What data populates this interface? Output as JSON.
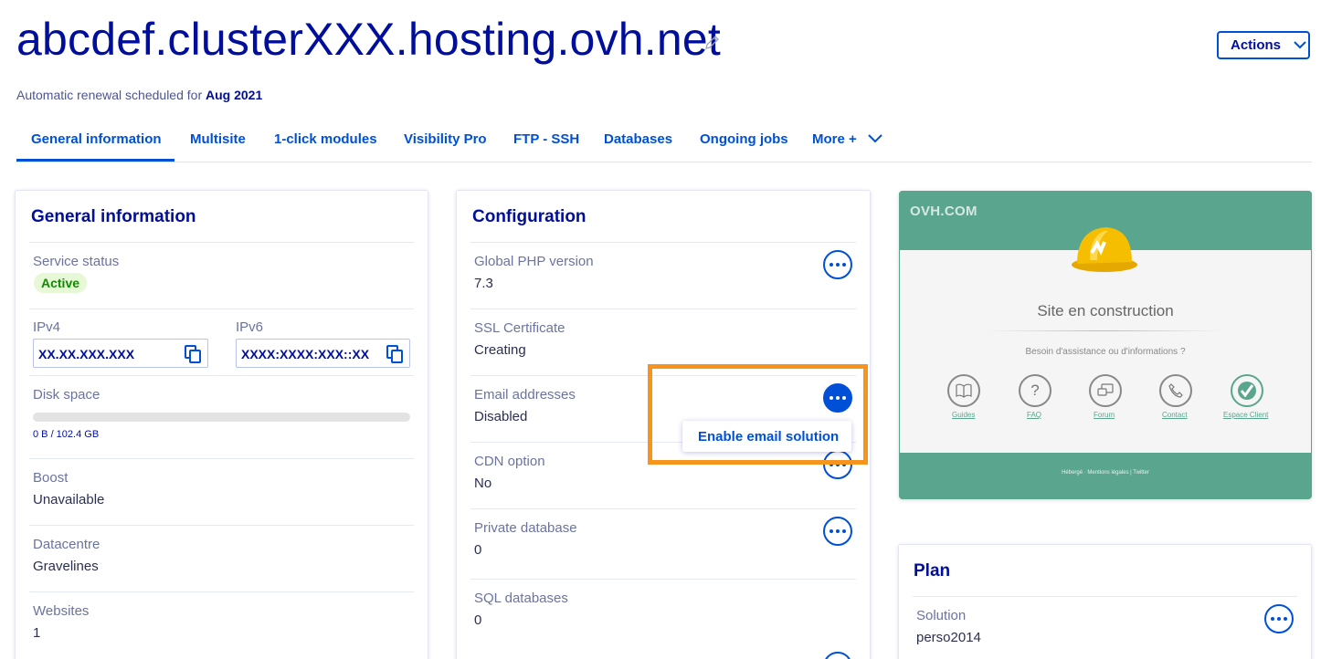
{
  "header": {
    "title": "abcdef.clusterXXX.hosting.ovh.net",
    "actions_label": "Actions",
    "renewal_text": "Automatic renewal scheduled for",
    "renewal_date": "Aug 2021"
  },
  "tabs": [
    {
      "label": "General information"
    },
    {
      "label": "Multisite"
    },
    {
      "label": "1-click modules"
    },
    {
      "label": "Visibility Pro"
    },
    {
      "label": "FTP - SSH"
    },
    {
      "label": "Databases"
    },
    {
      "label": "Ongoing jobs"
    },
    {
      "label": "More +"
    }
  ],
  "general": {
    "title": "General information",
    "service_status_label": "Service status",
    "service_status_value": "Active",
    "ipv4_label": "IPv4",
    "ipv4_value": "XX.XX.XXX.XXX",
    "ipv6_label": "IPv6",
    "ipv6_value": "XXXX:XXXX:XXX::XX",
    "disk_label": "Disk space",
    "disk_usage": "0 B / 102.4 GB",
    "disk_fraction": 0.0,
    "boost_label": "Boost",
    "boost_value": "Unavailable",
    "datacentre_label": "Datacentre",
    "datacentre_value": "Gravelines",
    "websites_label": "Websites",
    "websites_value": "1"
  },
  "configuration": {
    "title": "Configuration",
    "php_label": "Global PHP version",
    "php_value": "7.3",
    "ssl_label": "SSL Certificate",
    "ssl_value": "Creating",
    "email_label": "Email addresses",
    "email_value": "Disabled",
    "cdn_label": "CDN option",
    "cdn_value": "No",
    "privdb_label": "Private database",
    "privdb_value": "0",
    "sqldb_label": "SQL databases",
    "sqldb_value": "0",
    "menu_item": "Enable email solution",
    "highlight_color": "#f7941d"
  },
  "preview": {
    "brand": "OVH.COM",
    "heading": "Site en construction",
    "subheading": "Besoin d'assistance ou d'informations ?",
    "links": [
      "Guides",
      "FAQ",
      "Forum",
      "Contact",
      "Espace Client"
    ],
    "icons": [
      "book-icon",
      "question-icon",
      "forum-icon",
      "phone-icon",
      "check-logo-icon"
    ],
    "footer": "Hébergé · Mentions légales | Twitter"
  },
  "plan": {
    "title": "Plan",
    "solution_label": "Solution",
    "solution_value": "perso2014"
  },
  "colors": {
    "primary": "#0050d7",
    "title": "#000e9c",
    "active_badge_bg": "#e6f8d5",
    "active_badge_text": "#118a00"
  }
}
